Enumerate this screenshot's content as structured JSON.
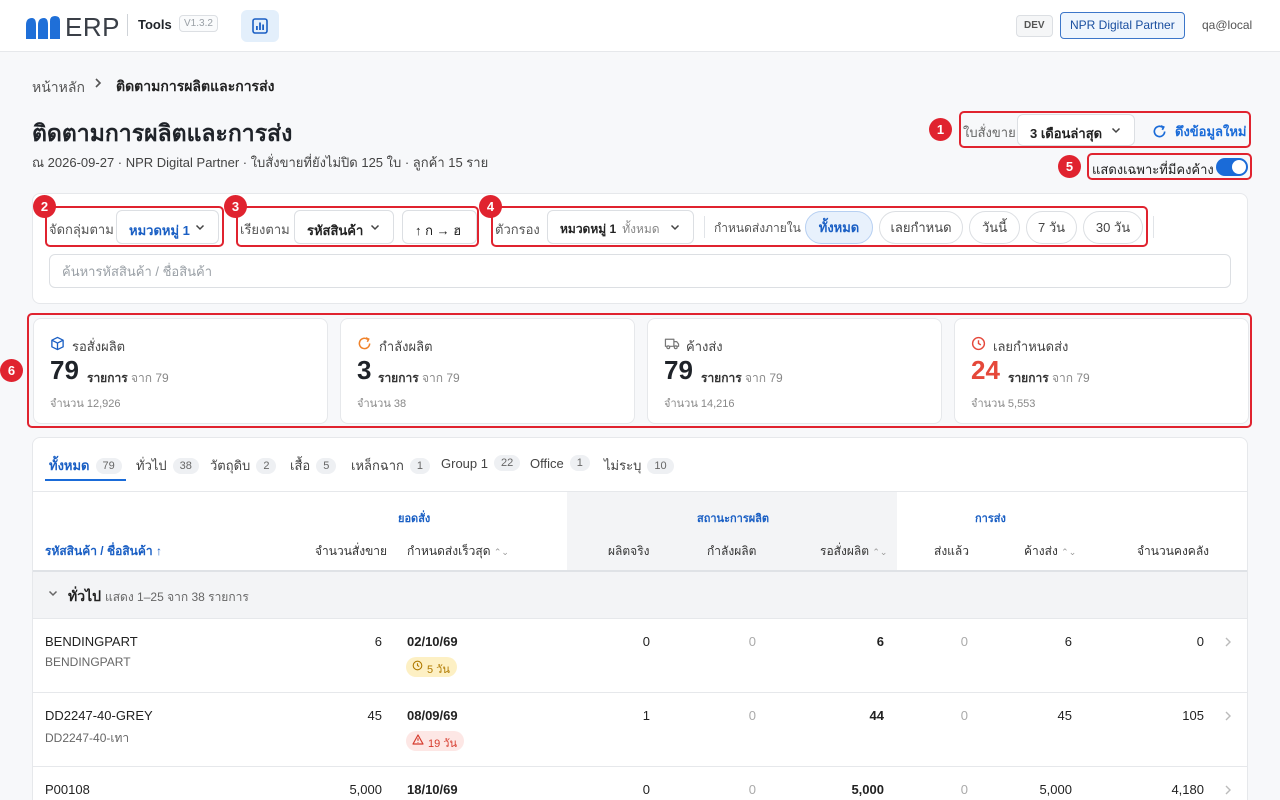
{
  "header": {
    "logo_text": "ERP",
    "app_name": "Tools",
    "version": "V1.3.2",
    "env": "DEV",
    "partner": "NPR Digital Partner",
    "user": "qa@local"
  },
  "breadcrumb": {
    "home": "หน้าหลัก",
    "separator": "›",
    "current": "ติดตามการผลิตและการส่ง"
  },
  "page": {
    "title": "ติดตามการผลิตและการส่ง",
    "subtitle": "ณ 2026-09-27 · NPR Digital Partner · ใบสั่งขายที่ยังไม่ปิด 125 ใบ · ลูกค้า 15 ราย"
  },
  "controls": {
    "so_label": "ใบสั่งขาย",
    "period": "3 เดือนล่าสุด",
    "refresh": "ดึงข้อมูลใหม่",
    "only_pending_label": "แสดงเฉพาะที่มีคงค้าง",
    "only_pending": true
  },
  "filters": {
    "group_label": "จัดกลุ่มตาม",
    "group_value": "หมวดหมู่ 1",
    "sort_label": "เรียงตาม",
    "sort_value": "รหัสสินค้า",
    "sort_dir": "↑  ก → ฮ",
    "filter_label": "ตัวกรอง",
    "filter_field": "หมวดหมู่ 1",
    "filter_value": "ทั้งหมด",
    "due_label": "กำหนดส่งภายใน",
    "due_chips": [
      "ทั้งหมด",
      "เลยกำหนด",
      "วันนี้",
      "7 วัน",
      "30 วัน"
    ],
    "due_active": "ทั้งหมด",
    "search_placeholder": "ค้นหารหัสสินค้า / ชื่อสินค้า"
  },
  "stats": [
    {
      "title": "รอสั่งผลิต",
      "value": "79",
      "unit": "รายการ",
      "of": "จาก 79",
      "qty": "จำนวน 12,926",
      "icon": "box-icon",
      "color": "#1a5fc4"
    },
    {
      "title": "กำลังผลิต",
      "value": "3",
      "unit": "รายการ",
      "of": "จาก 79",
      "qty": "จำนวน 38",
      "icon": "refresh-icon",
      "color": "#f0822a"
    },
    {
      "title": "ค้างส่ง",
      "value": "79",
      "unit": "รายการ",
      "of": "จาก 79",
      "qty": "จำนวน 14,216",
      "icon": "truck-icon",
      "color": "#777777"
    },
    {
      "title": "เลยกำหนดส่ง",
      "value": "24",
      "unit": "รายการ",
      "of": "จาก 79",
      "qty": "จำนวน 5,553",
      "icon": "clock-icon",
      "color": "#e5483a"
    }
  ],
  "tabs": [
    {
      "label": "ทั้งหมด",
      "count": "79"
    },
    {
      "label": "ทั่วไป",
      "count": "38"
    },
    {
      "label": "วัตถุดิบ",
      "count": "2"
    },
    {
      "label": "เสื้อ",
      "count": "5"
    },
    {
      "label": "เหล็กฉาก",
      "count": "1"
    },
    {
      "label": "Group 1",
      "count": "22"
    },
    {
      "label": "Office",
      "count": "1"
    },
    {
      "label": "ไม่ระบุ",
      "count": "10"
    }
  ],
  "table": {
    "groups": {
      "order": "ยอดสั่ง",
      "production": "สถานะการผลิต",
      "shipping": "การส่ง"
    },
    "columns": {
      "product": "รหัสสินค้า / ชื่อสินค้า ↑",
      "order_qty": "จำนวนสั่งขาย",
      "earliest_due": "กำหนดส่งเร็วสุด",
      "produced": "ผลิตจริง",
      "in_production": "กำลังผลิต",
      "to_order": "รอสั่งผลิต",
      "shipped": "ส่งแล้ว",
      "pending_ship": "ค้างส่ง",
      "stock": "จำนวนคงคลัง"
    },
    "group_row": {
      "name": "ทั่วไป",
      "info": "แสดง 1–25 จาก 38 รายการ"
    },
    "rows": [
      {
        "code": "BENDINGPART",
        "name": "BENDINGPART",
        "qty": "6",
        "due": "02/10/69",
        "badge": "5 วัน",
        "badge_type": "yellow",
        "produced": "0",
        "in_prod": "0",
        "to_order": "6",
        "shipped": "0",
        "pending": "6",
        "stock": "0"
      },
      {
        "code": "DD2247-40-GREY",
        "name": "DD2247-40-เทา",
        "qty": "45",
        "due": "08/09/69",
        "badge": "19 วัน",
        "badge_type": "red",
        "produced": "1",
        "in_prod": "0",
        "to_order": "44",
        "shipped": "0",
        "pending": "45",
        "stock": "105"
      },
      {
        "code": "P00108",
        "name": "",
        "qty": "5,000",
        "due": "18/10/69",
        "badge": "",
        "badge_type": "",
        "produced": "0",
        "in_prod": "0",
        "to_order": "5,000",
        "shipped": "0",
        "pending": "5,000",
        "stock": "4,180"
      }
    ]
  },
  "annotations": [
    "1",
    "2",
    "3",
    "4",
    "5",
    "6"
  ],
  "colors": {
    "accent": "#1a6bd8",
    "annotation": "#e0232f",
    "danger": "#e5483a"
  }
}
